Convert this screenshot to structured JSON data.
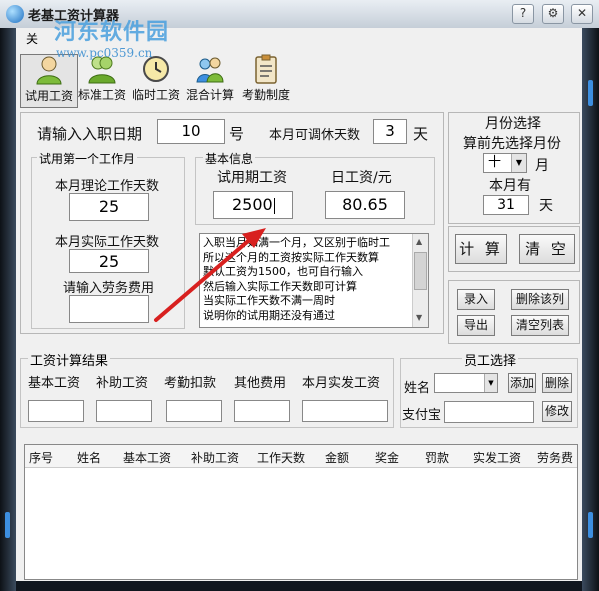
{
  "window": {
    "title": "老基工资计算器",
    "watermark": "河东软件园",
    "watermark_url": "www.pc0359.cn"
  },
  "menu": {
    "label": "关"
  },
  "toolbar": {
    "items": [
      {
        "label": "试用工资",
        "icon": "user-icon",
        "active": true
      },
      {
        "label": "标准工资",
        "icon": "users-icon",
        "active": false
      },
      {
        "label": "临时工资",
        "icon": "clock-icon",
        "active": false
      },
      {
        "label": "混合计算",
        "icon": "group-icon",
        "active": false
      },
      {
        "label": "考勤制度",
        "icon": "clipboard-icon",
        "active": false
      }
    ]
  },
  "entry": {
    "date_label": "请输入入职日期",
    "date_value": "10",
    "date_unit": "号",
    "rest_label": "本月可调休天数",
    "rest_value": "3",
    "rest_unit": "天"
  },
  "first_month": {
    "title": "试用第一个工作月",
    "theory_label": "本月理论工作天数",
    "theory_value": "25",
    "actual_label": "本月实际工作天数",
    "actual_value": "25",
    "labor_label": "请输入劳务费用",
    "labor_value": ""
  },
  "basic_info": {
    "title": "基本信息",
    "trial_label": "试用期工资",
    "trial_value": "2500",
    "daily_label": "日工资/元",
    "daily_value": "80.65",
    "notes": [
      "入职当月如满一个月，又区别于临时工",
      "所以这个月的工资按实际工作天数算",
      "默认工资为1500，也可自行输入",
      "然后输入实际工作天数即可计算",
      "当实际工作天数不满一周时",
      "说明你的试用期还没有通过"
    ]
  },
  "month_select": {
    "title": "月份选择",
    "hint": "算前先选择月份",
    "month_value": "十",
    "month_unit": "月",
    "days_label": "本月有",
    "days_value": "31",
    "days_unit": "天"
  },
  "actions": {
    "calc": "计 算",
    "clear": "清 空",
    "record": "录入",
    "delete_row": "删除该列",
    "export": "导出",
    "clear_list": "清空列表"
  },
  "result": {
    "title": "工资计算结果",
    "fields": [
      {
        "label": "基本工资",
        "value": ""
      },
      {
        "label": "补助工资",
        "value": ""
      },
      {
        "label": "考勤扣款",
        "value": ""
      },
      {
        "label": "其他费用",
        "value": ""
      },
      {
        "label": "本月实发工资",
        "value": ""
      }
    ]
  },
  "employee": {
    "title": "员工选择",
    "name_label": "姓名",
    "name_value": "",
    "add": "添加",
    "delete": "删除",
    "alipay_label": "支付宝",
    "alipay_value": "",
    "edit": "修改"
  },
  "table": {
    "columns": [
      "序号",
      "姓名",
      "基本工资",
      "补助工资",
      "工作天数",
      "金额",
      "奖金",
      "罚款",
      "实发工资",
      "劳务费"
    ],
    "rows": []
  },
  "colors": {
    "accent": "#3d8fe0",
    "arrow": "#d8201f",
    "frame": "#1f2d3d"
  }
}
